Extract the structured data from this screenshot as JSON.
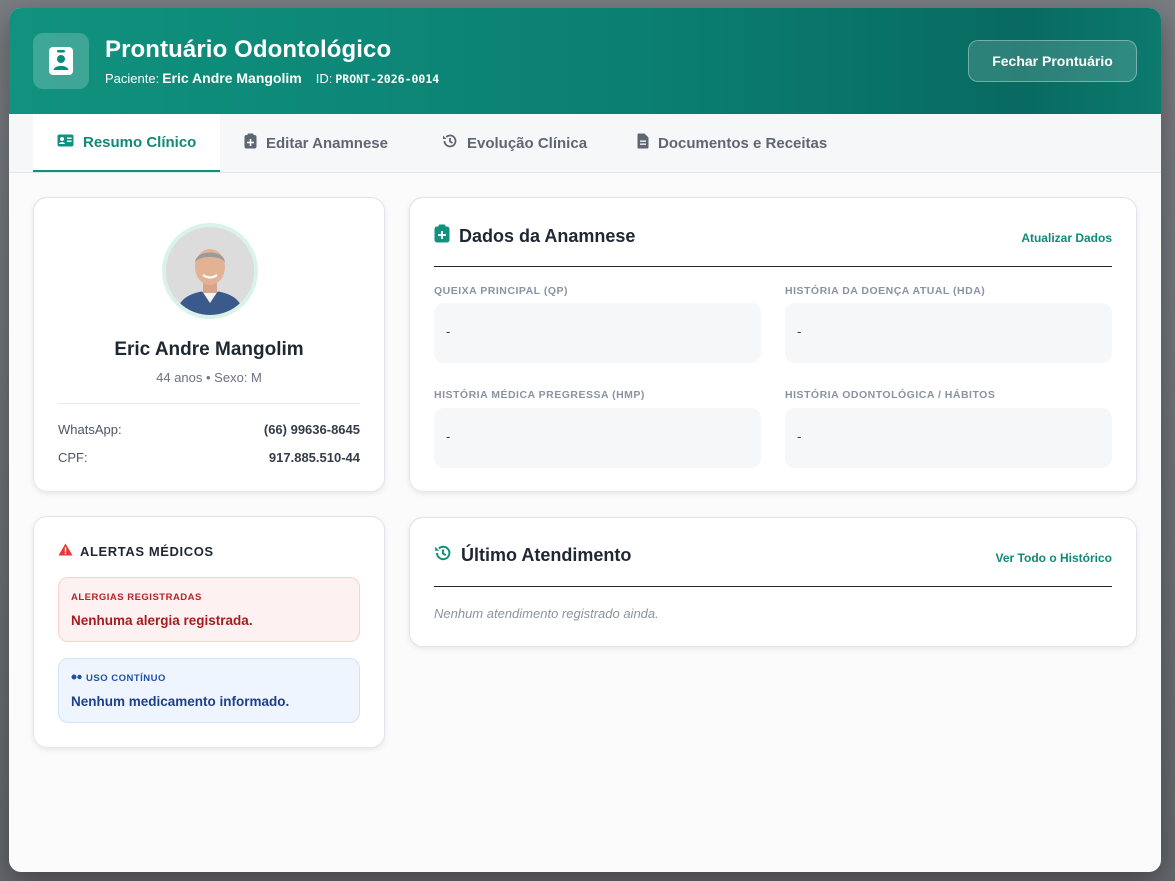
{
  "header": {
    "title": "Prontuário Odontológico",
    "patient_label": "Paciente:",
    "patient_name": "Eric Andre Mangolim",
    "id_label": "ID:",
    "id_value": "PRONT-2026-0014",
    "close_button": "Fechar Prontuário",
    "icon": "id-badge-icon"
  },
  "tabs": [
    {
      "label": "Resumo Clínico",
      "icon": "id-card-icon",
      "active": true
    },
    {
      "label": "Editar Anamnese",
      "icon": "clipboard-plus-icon",
      "active": false
    },
    {
      "label": "Evolução Clínica",
      "icon": "history-icon",
      "active": false
    },
    {
      "label": "Documentos e Receitas",
      "icon": "file-icon",
      "active": false
    }
  ],
  "profile": {
    "name": "Eric Andre Mangolim",
    "meta": "44 anos • Sexo: M",
    "whatsapp_label": "WhatsApp:",
    "whatsapp_value": "(66) 99636-8645",
    "cpf_label": "CPF:",
    "cpf_value": "917.885.510-44"
  },
  "alerts": {
    "title": "ALERTAS MÉDICOS",
    "allergies_label": "ALERGIAS REGISTRADAS",
    "allergies_text": "Nenhuma alergia registrada.",
    "continuous_label": "USO CONTÍNUO",
    "continuous_text": "Nenhum medicamento informado."
  },
  "anamnese": {
    "title": "Dados da Anamnese",
    "link": "Atualizar Dados",
    "fields": [
      {
        "label": "QUEIXA PRINCIPAL (QP)",
        "value": "-"
      },
      {
        "label": "HISTÓRIA DA DOENÇA ATUAL (HDA)",
        "value": "-"
      },
      {
        "label": "HISTÓRIA MÉDICA PREGRESSA (HMP)",
        "value": "-"
      },
      {
        "label": "HISTÓRIA ODONTOLÓGICA / HÁBITOS",
        "value": "-"
      }
    ]
  },
  "last_visit": {
    "title": "Último Atendimento",
    "link": "Ver Todo o Histórico",
    "empty_text": "Nenhum atendimento registrado ainda."
  },
  "colors": {
    "brand": "#10927e",
    "brand_dark": "#086a60",
    "danger": "#e53935",
    "info": "#1f4fa8"
  }
}
